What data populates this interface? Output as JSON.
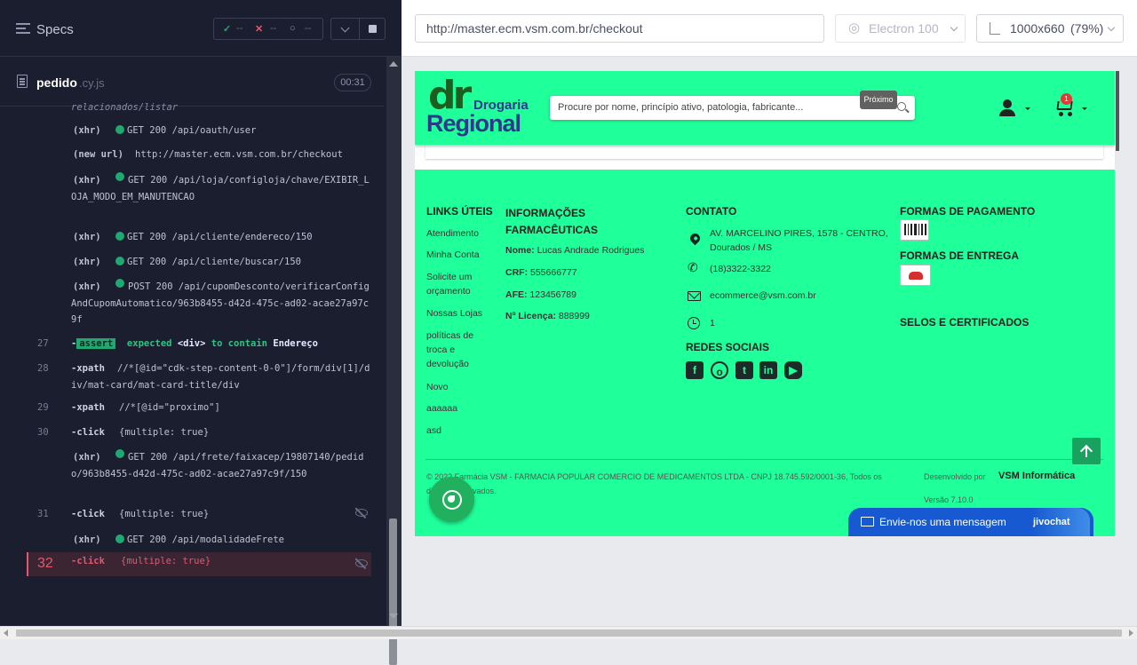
{
  "reporter": {
    "specs_label": "Specs",
    "stats": {
      "passed": "--",
      "failed": "--",
      "pending": "--"
    },
    "spec": {
      "name": "pedido",
      "ext": ".cy.js",
      "duration": "00:31"
    },
    "cut_text": "relacionados/listar",
    "log": [
      {
        "type": "xhr",
        "label": "(xhr)",
        "text": "GET 200 /api/oauth/user"
      },
      {
        "type": "newurl",
        "label": "(new url)",
        "text": "http://master.ecm.vsm.com.br/checkout"
      },
      {
        "type": "xhr",
        "label": "(xhr)",
        "text": "GET 200 /api/loja/configloja/chave/EXIBIR_LOJA_MODO_EM_MANUTENCAO"
      },
      {
        "type": "xhr",
        "label": "(xhr)",
        "text": "GET 200 /api/cliente/endereco/150"
      },
      {
        "type": "xhr",
        "label": "(xhr)",
        "text": "GET 200 /api/cliente/buscar/150"
      },
      {
        "type": "xhr",
        "label": "(xhr)",
        "text": "POST 200 /api/cupomDesconto/verificarConfigAndCupomAutomatico/963b8455-d42d-475c-ad02-acae27a97c9f"
      },
      {
        "type": "assert",
        "num": "27",
        "cmd": "-",
        "tag": "assert",
        "text_pre": "expected",
        "el": "<div>",
        "text_mid": "to contain",
        "val": "Endereço"
      },
      {
        "type": "cmd",
        "num": "28",
        "cmd": "-xpath",
        "arg": "//*[@id=\"cdk-step-content-0-0\"]/form/div[1]/div/mat-card/mat-card-title/div"
      },
      {
        "type": "cmd",
        "num": "29",
        "cmd": "-xpath",
        "arg": "//*[@id=\"proximo\"]"
      },
      {
        "type": "cmd",
        "num": "30",
        "cmd": "-click",
        "arg": "{multiple: true}"
      },
      {
        "type": "xhr",
        "label": "(xhr)",
        "text": "GET 200 /api/frete/faixacep/19807140/pedido/963b8455-d42d-475c-ad02-acae27a97c9f/150"
      },
      {
        "type": "cmd",
        "num": "31",
        "cmd": "-click",
        "arg": "{multiple: true}"
      },
      {
        "type": "xhr",
        "label": "(xhr)",
        "text": "GET 200 /api/modalidadeFrete"
      },
      {
        "type": "cmd",
        "num": "32",
        "cmd": "-click",
        "arg": "{multiple: true}"
      }
    ]
  },
  "aut": {
    "url": "http://master.ecm.vsm.com.br/checkout",
    "browser": "Electron 100",
    "viewport": "1000x660",
    "scale": "(79%)"
  },
  "site": {
    "logo": {
      "dr": "dr",
      "drogaria": "Drogaria",
      "regional": "Regional"
    },
    "search_placeholder": "Procure por nome, princípio ativo, patologia, fabricante...",
    "tooltip": "Próximo",
    "cart_count": "1",
    "links_title": "LINKS ÚTEIS",
    "links": [
      "Atendimento",
      "Minha Conta",
      "Solicite um orçamento",
      "Nossas Lojas",
      "políticas de troca e devolução",
      "Novo",
      "aaaaaa",
      "asd"
    ],
    "info_title": "INFORMAÇÕES FARMACÊUTICAS",
    "info": [
      {
        "k": "Nome:",
        "v": "Lucas Andrade Rodrigues"
      },
      {
        "k": "CRF:",
        "v": "555666777"
      },
      {
        "k": "AFE:",
        "v": "123456789"
      },
      {
        "k": "Nº Licença:",
        "v": "888999"
      }
    ],
    "contact_title": "CONTATO",
    "address": "AV. MARCELINO PIRES, 1578 - CENTRO, Dourados / MS",
    "phone": "(18)3322-3322",
    "email": "ecommerce@vsm.com.br",
    "hours": "1",
    "social_title": "REDES SOCIAIS",
    "social_icons": [
      "facebook-icon",
      "instagram-icon",
      "twitter-icon",
      "linkedin-icon",
      "youtube-icon"
    ],
    "payment_title": "FORMAS DE PAGAMENTO",
    "delivery_title": "FORMAS DE ENTREGA",
    "seals_title": "SELOS E CERTIFICADOS",
    "copyright_1": "© 2022 Farmácia VSM - FARMACIA POPULAR COMERCIO DE MEDICAMENTOS LTDA - CNPJ 18.745.592/0001-36, Todos os",
    "copyright_2": "direitos reservados.",
    "dev_by": "Desenvolvido por",
    "dev_name": "VSM Informática",
    "version": "Versão 7.10.0",
    "chat_label": "Envie-nos uma mensagem",
    "chat_brand": "jivochat",
    "colors": {
      "site_bg": "#1fff9a",
      "reporter_bg": "#1b1e2e",
      "pass": "#1fa971",
      "fail": "#e45770",
      "chat": "#1759d0"
    }
  }
}
